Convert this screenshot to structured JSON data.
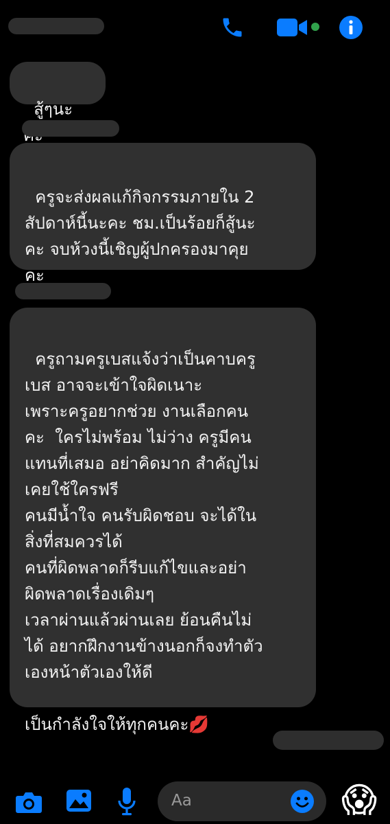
{
  "header": {
    "contact_name_redacted": "",
    "icons": [
      "phone-icon",
      "video-call-icon",
      "info-icon"
    ],
    "online_indicator_color": "#31a24c",
    "accent_color": "#0a7cff"
  },
  "messages": [
    {
      "sender": "other",
      "text": "สู้ๆนะคะ"
    },
    {
      "sender": "other",
      "text": "ครูจะส่งผลแก้กิจกรรมภายใน 2\nสัปดาห์นี้นะคะ ชม.เป็นร้อยก็สู้นะ\nคะ จบห้วงนี้เชิญผู้ปกครองมาคุย\nคะ"
    },
    {
      "sender": "other",
      "text": "ครูถามครูเบสแจ้งว่าเป็นคาบครู\nเบส อาจจะเข้าใจผิดเนาะ\nเพราะครูอยากช่วย งานเลือกคน\nคะ  ใครไม่พร้อม ไม่ว่าง ครูมีคน\nแทนที่เสมอ อย่าคิดมาก สำคัญไม่\nเคยใช้ใครฟรี\nคนมีน้ำใจ คนรับผิดชอบ จะได้ใน\nสิ่งที่สมควรได้\nคนที่ผิดพลาดก็รีบแก้ไขและอย่า\nผิดพลาดเรื่องเดิมๆ\nเวลาผ่านแล้วผ่านเลย ย้อนคืนไม่\nได้ อยากฝึกงานข้างนอกก็จงทำตัว\nเองหน้าตัวเองให้ดี\n\nเป็นกำลังใจให้ทุกคนคะ💋"
    }
  ],
  "composer": {
    "placeholder": "Aa",
    "icons": [
      "camera-icon",
      "gallery-icon",
      "microphone-icon",
      "emoji-icon"
    ],
    "quick_reaction": "😱"
  }
}
